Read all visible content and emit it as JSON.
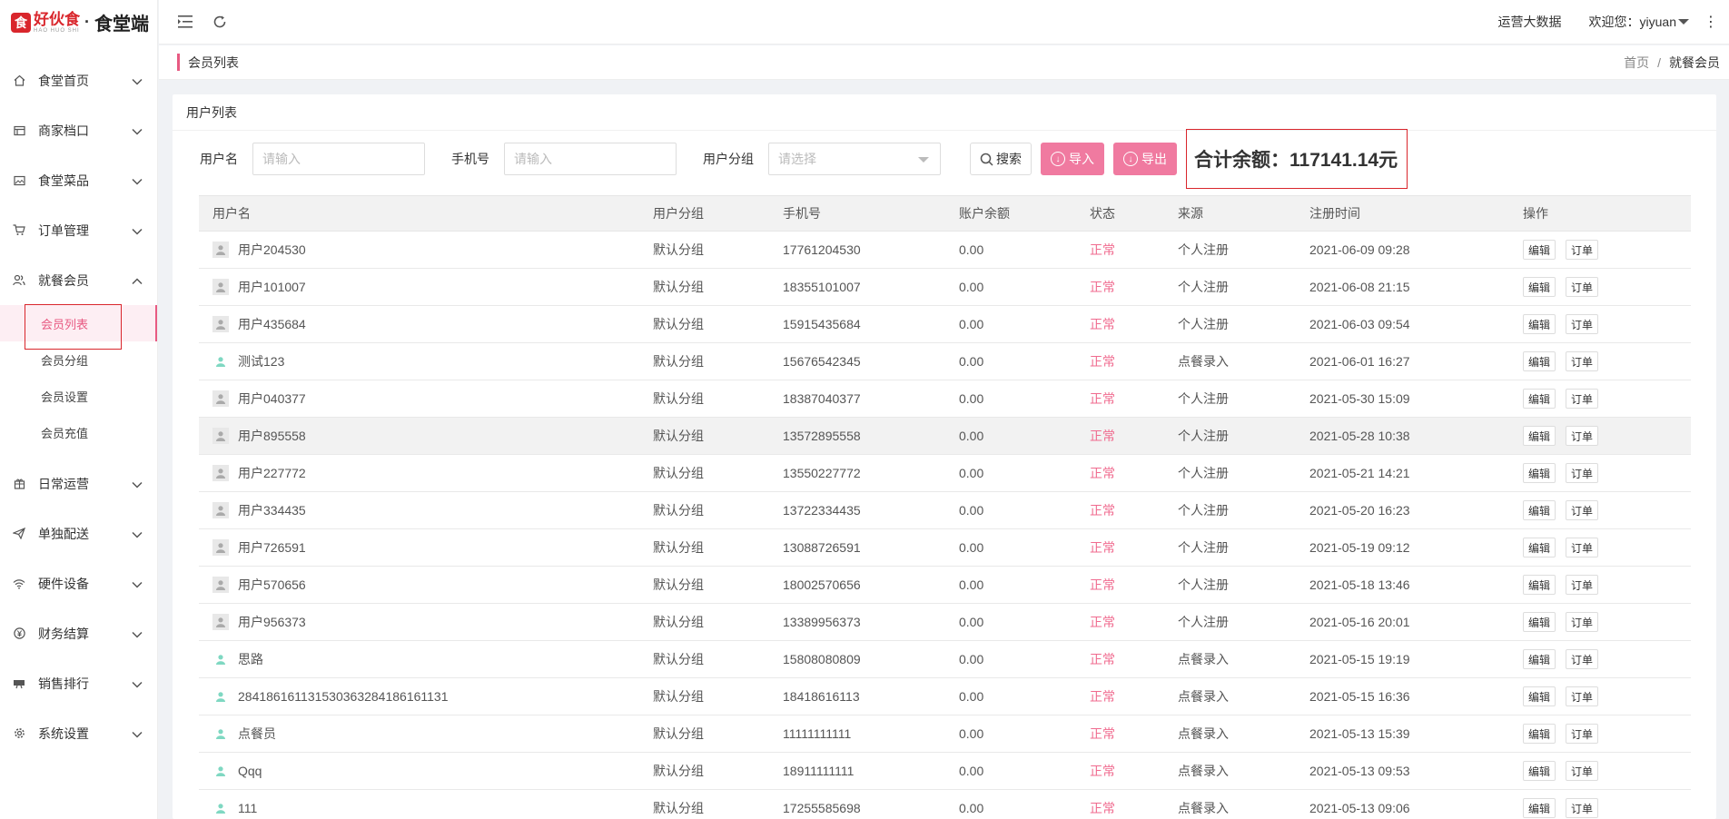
{
  "logo": {
    "mark": "食",
    "brand": "好伙食",
    "brand_sub": "HAO HUO SHI",
    "sep": "·",
    "name": "食堂端"
  },
  "sidebar": {
    "items": [
      {
        "label": "食堂首页",
        "icon": "home-icon"
      },
      {
        "label": "商家档口",
        "icon": "store-icon"
      },
      {
        "label": "食堂菜品",
        "icon": "dish-image-icon"
      },
      {
        "label": "订单管理",
        "icon": "cart-icon"
      },
      {
        "label": "就餐会员",
        "icon": "users-icon",
        "expanded": true,
        "children": [
          "会员列表",
          "会员分组",
          "会员设置",
          "会员充值"
        ],
        "active_child": "会员列表"
      },
      {
        "label": "日常运营",
        "icon": "gift-icon"
      },
      {
        "label": "单独配送",
        "icon": "send-icon"
      },
      {
        "label": "硬件设备",
        "icon": "wifi-icon"
      },
      {
        "label": "财务结算",
        "icon": "yen-icon"
      },
      {
        "label": "销售排行",
        "icon": "rank-icon"
      },
      {
        "label": "系统设置",
        "icon": "gear-icon"
      }
    ]
  },
  "header": {
    "ops_data": "运营大数据",
    "welcome": "欢迎您：yiyuan"
  },
  "crumbbar": {
    "title": "会员列表",
    "crumbs": [
      "首页",
      "就餐会员"
    ]
  },
  "card": {
    "title": "用户列表"
  },
  "filters": {
    "username_label": "用户名",
    "username_placeholder": "请输入",
    "phone_label": "手机号",
    "phone_placeholder": "请输入",
    "group_label": "用户分组",
    "group_placeholder": "请选择",
    "search_btn": "搜索",
    "import_btn": "导入",
    "export_btn": "导出"
  },
  "total": "合计余额：117141.14元",
  "table": {
    "headers": [
      "用户名",
      "用户分组",
      "手机号",
      "账户余额",
      "状态",
      "来源",
      "注册时间",
      "操作"
    ],
    "edit_label": "编辑",
    "order_label": "订单",
    "rows": [
      {
        "name": "用户204530",
        "avatar": "gray",
        "group": "默认分组",
        "phone": "17761204530",
        "balance": "0.00",
        "status": "正常",
        "source": "个人注册",
        "time": "2021-06-09 09:28"
      },
      {
        "name": "用户101007",
        "avatar": "gray",
        "group": "默认分组",
        "phone": "18355101007",
        "balance": "0.00",
        "status": "正常",
        "source": "个人注册",
        "time": "2021-06-08 21:15"
      },
      {
        "name": "用户435684",
        "avatar": "gray",
        "group": "默认分组",
        "phone": "15915435684",
        "balance": "0.00",
        "status": "正常",
        "source": "个人注册",
        "time": "2021-06-03 09:54"
      },
      {
        "name": "测试123",
        "avatar": "teal",
        "group": "默认分组",
        "phone": "15676542345",
        "balance": "0.00",
        "status": "正常",
        "source": "点餐录入",
        "time": "2021-06-01 16:27"
      },
      {
        "name": "用户040377",
        "avatar": "gray",
        "group": "默认分组",
        "phone": "18387040377",
        "balance": "0.00",
        "status": "正常",
        "source": "个人注册",
        "time": "2021-05-30 15:09"
      },
      {
        "name": "用户895558",
        "avatar": "gray",
        "group": "默认分组",
        "phone": "13572895558",
        "balance": "0.00",
        "status": "正常",
        "source": "个人注册",
        "time": "2021-05-28 10:38",
        "hover": true
      },
      {
        "name": "用户227772",
        "avatar": "gray",
        "group": "默认分组",
        "phone": "13550227772",
        "balance": "0.00",
        "status": "正常",
        "source": "个人注册",
        "time": "2021-05-21 14:21"
      },
      {
        "name": "用户334435",
        "avatar": "gray",
        "group": "默认分组",
        "phone": "13722334435",
        "balance": "0.00",
        "status": "正常",
        "source": "个人注册",
        "time": "2021-05-20 16:23"
      },
      {
        "name": "用户726591",
        "avatar": "gray",
        "group": "默认分组",
        "phone": "13088726591",
        "balance": "0.00",
        "status": "正常",
        "source": "个人注册",
        "time": "2021-05-19 09:12"
      },
      {
        "name": "用户570656",
        "avatar": "gray",
        "group": "默认分组",
        "phone": "18002570656",
        "balance": "0.00",
        "status": "正常",
        "source": "个人注册",
        "time": "2021-05-18 13:46"
      },
      {
        "name": "用户956373",
        "avatar": "gray",
        "group": "默认分组",
        "phone": "13389956373",
        "balance": "0.00",
        "status": "正常",
        "source": "个人注册",
        "time": "2021-05-16 20:01"
      },
      {
        "name": "思路",
        "avatar": "teal",
        "group": "默认分组",
        "phone": "15808080809",
        "balance": "0.00",
        "status": "正常",
        "source": "点餐录入",
        "time": "2021-05-15 19:19"
      },
      {
        "name": "28418616113153036328418616113​1",
        "avatar": "teal",
        "group": "默认分组",
        "phone": "18418616113",
        "balance": "0.00",
        "status": "正常",
        "source": "点餐录入",
        "time": "2021-05-15 16:36"
      },
      {
        "name": "点餐员",
        "avatar": "teal",
        "group": "默认分组",
        "phone": "11111111111",
        "balance": "0.00",
        "status": "正常",
        "source": "点餐录入",
        "time": "2021-05-13 15:39"
      },
      {
        "name": "Qqq",
        "avatar": "teal",
        "group": "默认分组",
        "phone": "18911111111",
        "balance": "0.00",
        "status": "正常",
        "source": "点餐录入",
        "time": "2021-05-13 09:53"
      },
      {
        "name": "111",
        "avatar": "teal",
        "group": "默认分组",
        "phone": "17255585698",
        "balance": "0.00",
        "status": "正常",
        "source": "点餐录入",
        "time": "2021-05-13 09:06"
      }
    ]
  }
}
